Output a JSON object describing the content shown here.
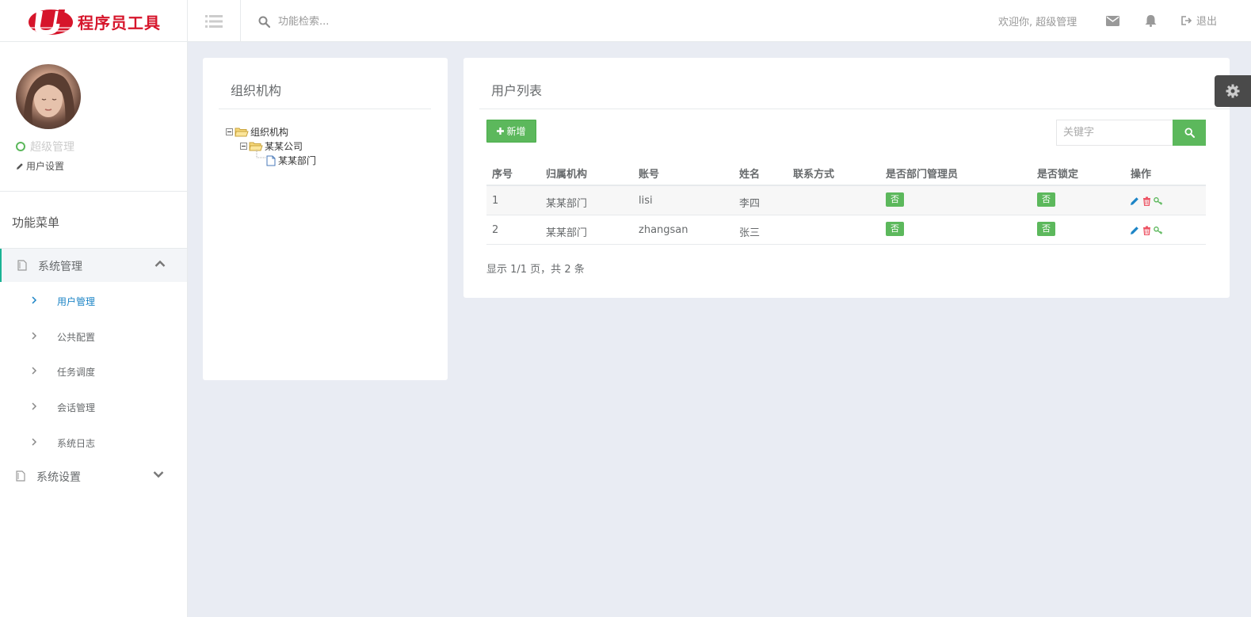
{
  "brand": {
    "name": "程序员工具",
    "color": "#d6152b"
  },
  "header": {
    "search_placeholder": "功能检索...",
    "welcome": "欢迎你, 超级管理",
    "logout": "退出"
  },
  "sidebar": {
    "role": "超级管理",
    "user_settings": "用户设置",
    "menu_title": "功能菜单",
    "groups": [
      {
        "label": "系统管理",
        "expanded": true
      },
      {
        "label": "系统设置",
        "expanded": false
      }
    ],
    "sub_items": [
      "用户管理",
      "公共配置",
      "任务调度",
      "会话管理",
      "系统日志"
    ]
  },
  "org_panel": {
    "title": "组织机构",
    "tree": [
      "组织机构",
      "某某公司",
      "某某部门"
    ]
  },
  "user_panel": {
    "title": "用户列表",
    "add_label": "新增",
    "keyword_placeholder": "关键字",
    "columns": [
      "序号",
      "归属机构",
      "账号",
      "姓名",
      "联系方式",
      "是否部门管理员",
      "是否锁定",
      "操作"
    ],
    "rows": [
      {
        "no": "1",
        "org": "某某部门",
        "account": "lisi",
        "name": "李四",
        "contact": "",
        "is_admin": "否",
        "locked": "否"
      },
      {
        "no": "2",
        "org": "某某部门",
        "account": "zhangsan",
        "name": "张三",
        "contact": "",
        "is_admin": "否",
        "locked": "否"
      }
    ],
    "pager": "显示 1/1 页，共 2 条"
  },
  "colors": {
    "accent_green": "#5cb85c",
    "link_blue": "#1c84c6",
    "delete_red": "#ed5565"
  }
}
